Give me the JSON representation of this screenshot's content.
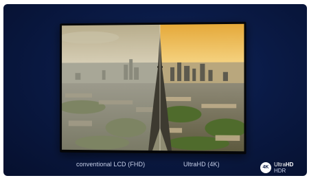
{
  "comparison": {
    "left_label": "conventional LCD (FHD)",
    "right_label": "UltraHD (4K)"
  },
  "badge": {
    "circle_text": "4K",
    "line1_a": "Ultra",
    "line1_b": "HD",
    "line2": "HDR"
  },
  "colors": {
    "background": "#0a1a45",
    "caption": "#c9d2ea"
  }
}
